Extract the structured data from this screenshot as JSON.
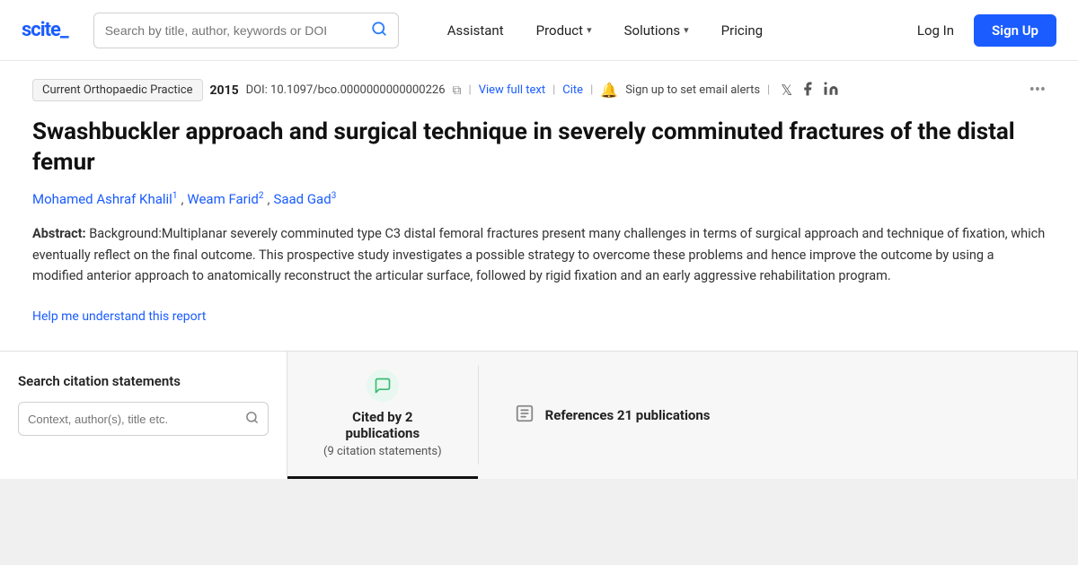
{
  "logo": {
    "text": "scite_"
  },
  "navbar": {
    "search_placeholder": "Search by title, author, keywords or DOI",
    "assistant_label": "Assistant",
    "product_label": "Product",
    "solutions_label": "Solutions",
    "pricing_label": "Pricing",
    "login_label": "Log In",
    "signup_label": "Sign Up"
  },
  "article": {
    "journal": "Current Orthopaedic Practice",
    "year": "2015",
    "doi": "DOI: 10.1097/bco.0000000000000226",
    "view_full_text": "View full text",
    "cite": "Cite",
    "alert_text": "Sign up to set email alerts",
    "title": "Swashbuckler approach and surgical technique in severely comminuted fractures of the distal femur",
    "authors": [
      {
        "name": "Mohamed Ashraf Khalil",
        "superscript": "1"
      },
      {
        "name": "Weam Farid",
        "superscript": "2"
      },
      {
        "name": "Saad Gad",
        "superscript": "3"
      }
    ],
    "abstract_label": "Abstract:",
    "abstract_text": "Background:Multiplanar severely comminuted type C3 distal femoral fractures present many challenges in terms of surgical approach and technique of fixation, which eventually reflect on the final outcome. This prospective study investigates a possible strategy to overcome these problems and hence improve the outcome by using a modified anterior approach to anatomically reconstruct the articular surface, followed by rigid fixation and an early aggressive rehabilitation program.",
    "help_link": "Help me understand this report"
  },
  "bottom": {
    "search_panel_title": "Search citation statements",
    "search_placeholder": "Context, author(s), title etc.",
    "cited_by_tab": {
      "label": "Cited by 2 publications",
      "label_bold": "Cited by 2",
      "label_second": "publications",
      "sub_label": "(9 citation statements)"
    },
    "references_tab": {
      "label": "References 21 publications"
    }
  },
  "colors": {
    "accent": "#1a5cff",
    "green_bg": "#e8f8f0",
    "green_icon": "#3dba74"
  }
}
